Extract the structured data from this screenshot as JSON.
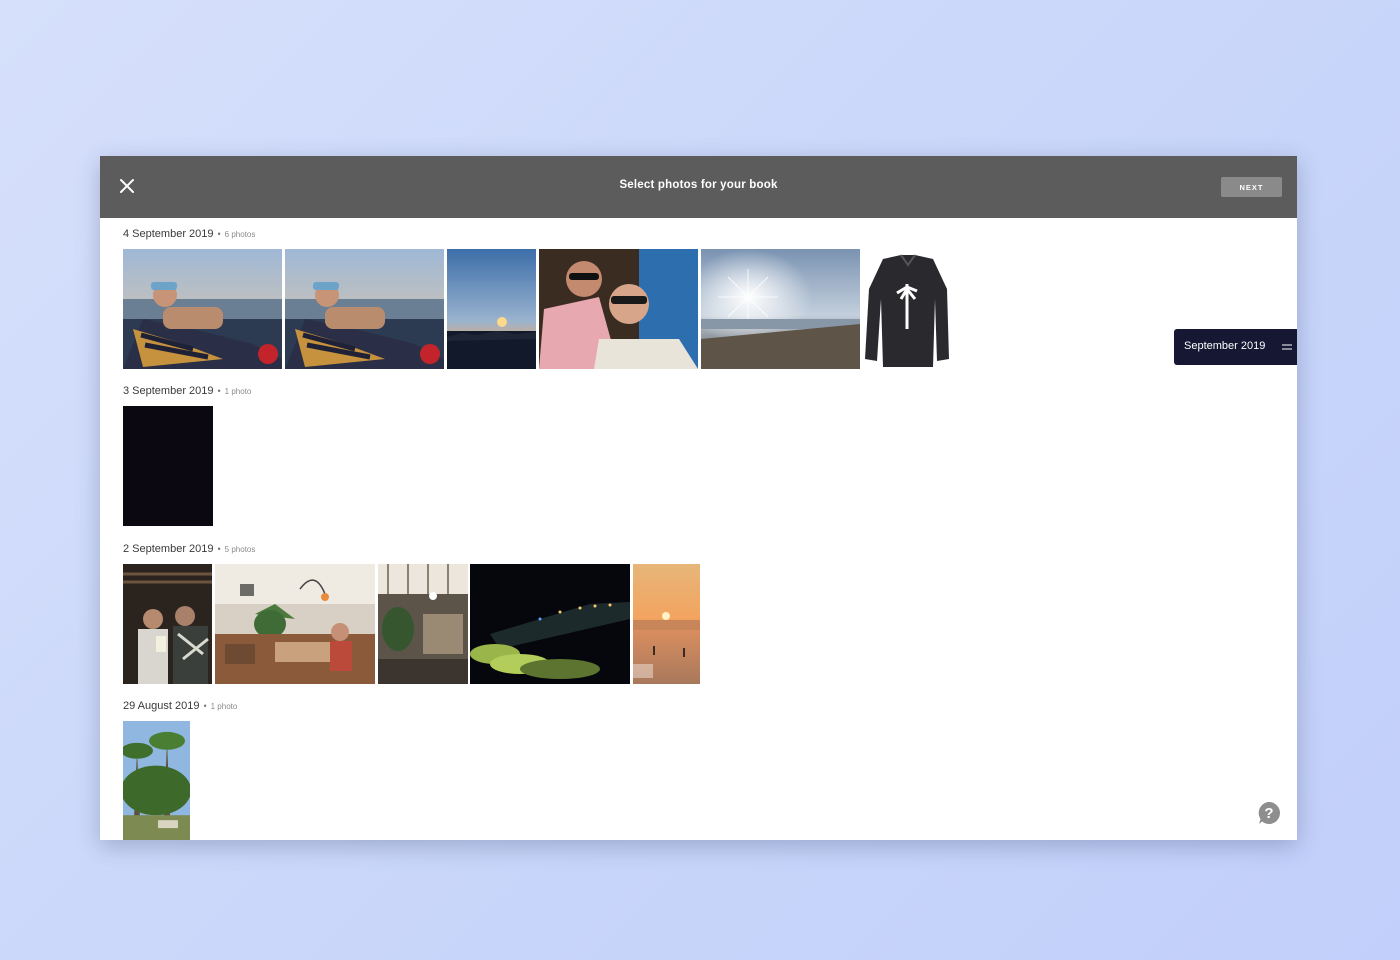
{
  "header": {
    "title": "Select photos for your book",
    "next_label": "NEXT",
    "close_icon": "close-icon"
  },
  "scrubber": {
    "label": "September 2019",
    "icon": "menu-lines-icon"
  },
  "help": {
    "icon": "help-icon",
    "glyph": "?"
  },
  "groups": [
    {
      "date": "4 September 2019",
      "count": "6 photos",
      "photos": [
        "man-lounging-sunset",
        "man-lounging-sunset-duplicate",
        "sunset-over-city",
        "couple-selfie-night",
        "sun-over-beach",
        "black-sweatshirt-palm-print"
      ]
    },
    {
      "date": "3 September 2019",
      "count": "1 photo",
      "photos": [
        "dark-photo"
      ]
    },
    {
      "date": "2 September 2019",
      "count": "5 photos",
      "photos": [
        "friends-at-bar",
        "restaurant-interior",
        "lobby-with-plants",
        "night-beachfront-lights",
        "beach-sunset-people"
      ]
    },
    {
      "date": "29 August 2019",
      "count": "1 photo",
      "photos": [
        "palm-trees-garden"
      ]
    }
  ],
  "colors": {
    "background": "#cbd7fa",
    "topbar": "#5c5c5c",
    "next_button": "#8a8a8a",
    "scrubber": "#151733"
  },
  "separator": "•"
}
